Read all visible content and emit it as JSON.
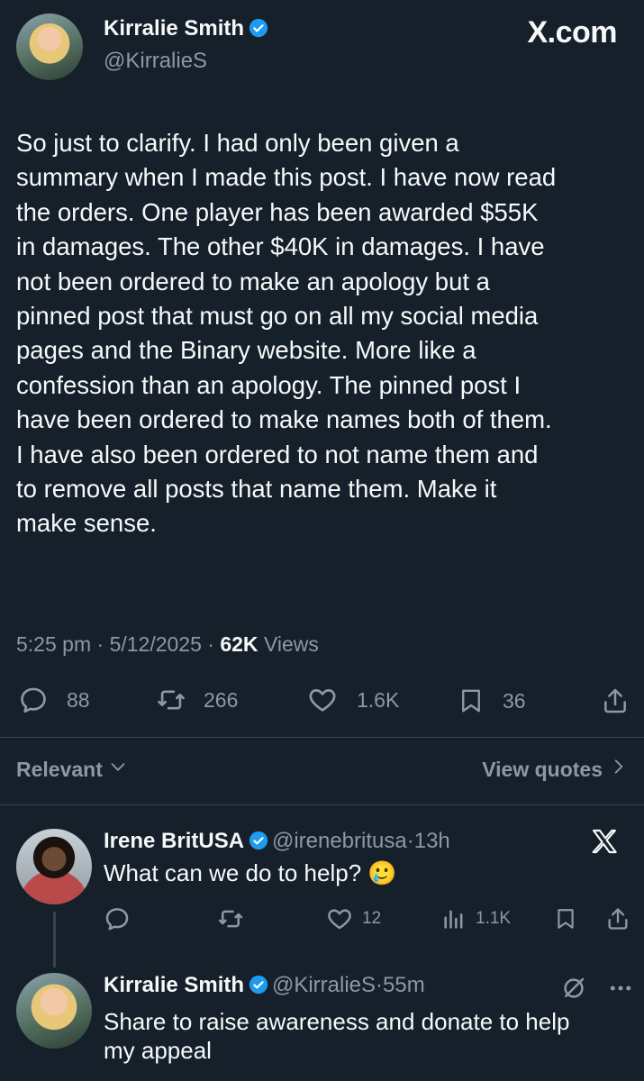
{
  "brand": "X.com",
  "main_post": {
    "author_name": "Kirralie Smith",
    "handle": "@KirralieS",
    "lines": [
      "So just to clarify. I had only been given a",
      "summary when I made this post. I have now read",
      "the orders. One player has been awarded $55K",
      "in damages. The other $40K in damages. I have",
      "not been ordered to make an apology but a",
      "pinned post that must go on all my social media",
      "pages and the Binary website. More like a",
      "confession than an apology. The pinned post I",
      "have been ordered to make names both of them.",
      "I have also been ordered to not name them and",
      "to remove all posts that name them. Make it",
      "make sense."
    ],
    "time": "5:25 pm",
    "date": "5/12/2025",
    "views_count": "62K",
    "views_label": "Views",
    "replies": "88",
    "reposts": "266",
    "likes": "1.6K",
    "bookmarks": "36"
  },
  "reply_bar": {
    "sort_label": "Relevant",
    "view_quotes": "View quotes"
  },
  "replies": [
    {
      "author_name": "Irene BritUSA",
      "handle": "@irenebritusa",
      "time": "13h",
      "text": "What can we do to help? 🥲",
      "replies": "",
      "reposts": "",
      "likes": "12",
      "views": "1.1K"
    },
    {
      "author_name": "Kirralie Smith",
      "handle": "@KirralieS",
      "time": "55m",
      "lines": [
        "Share to raise awareness and donate to help",
        "my appeal"
      ]
    }
  ],
  "colors": {
    "background": "#15202b",
    "text": "#f7f9f9",
    "secondary": "#8b98a5",
    "verified": "#1d9bf0"
  }
}
